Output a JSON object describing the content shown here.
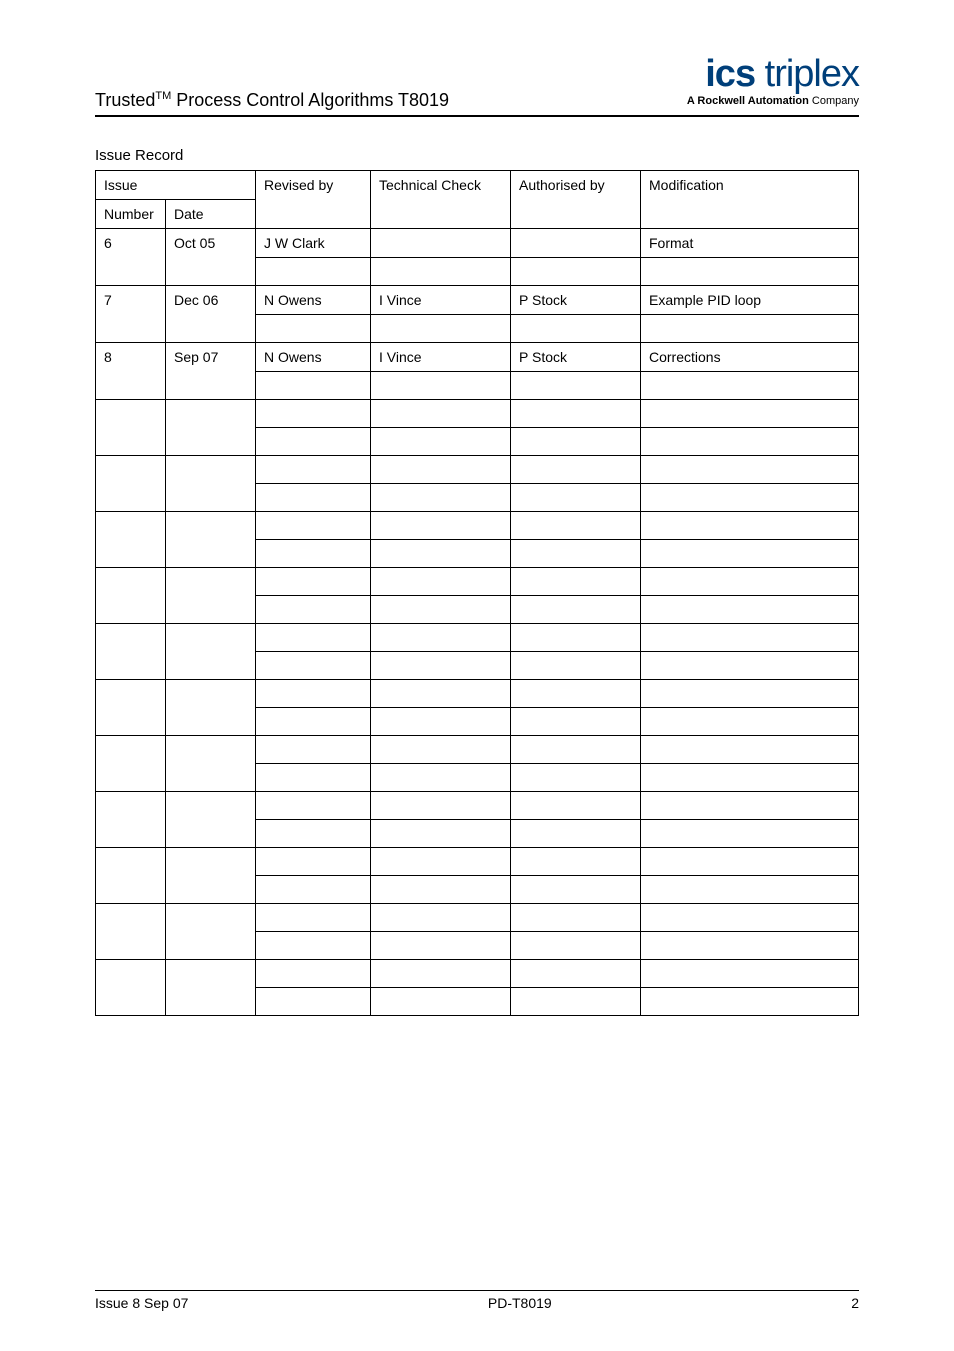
{
  "header": {
    "title_prefix": "Trusted",
    "title_sup": "TM",
    "title_suffix": " Process Control Algorithms T8019",
    "logo_ics": "ics",
    "logo_triplex": " triplex",
    "logo_tagline_bold": "A Rockwell Automation ",
    "logo_tagline_rest": "Company"
  },
  "section_title": "Issue Record",
  "table": {
    "group_header": "Issue",
    "columns": [
      "Number",
      "Date",
      "Revised by",
      "Technical Check",
      "Authorised by",
      "Modification"
    ],
    "rows": [
      {
        "number": "6",
        "date": "Oct 05",
        "revised": "J W Clark",
        "tech": "",
        "auth": "",
        "mod": "Format"
      },
      {
        "number": "7",
        "date": "Dec 06",
        "revised": "N Owens",
        "tech": "I Vince",
        "auth": "P Stock",
        "mod": "Example PID loop"
      },
      {
        "number": "8",
        "date": "Sep 07",
        "revised": "N Owens",
        "tech": "I Vince",
        "auth": "P Stock",
        "mod": "Corrections"
      },
      {
        "number": "",
        "date": "",
        "revised": "",
        "tech": "",
        "auth": "",
        "mod": ""
      },
      {
        "number": "",
        "date": "",
        "revised": "",
        "tech": "",
        "auth": "",
        "mod": ""
      },
      {
        "number": "",
        "date": "",
        "revised": "",
        "tech": "",
        "auth": "",
        "mod": ""
      },
      {
        "number": "",
        "date": "",
        "revised": "",
        "tech": "",
        "auth": "",
        "mod": ""
      },
      {
        "number": "",
        "date": "",
        "revised": "",
        "tech": "",
        "auth": "",
        "mod": ""
      },
      {
        "number": "",
        "date": "",
        "revised": "",
        "tech": "",
        "auth": "",
        "mod": ""
      },
      {
        "number": "",
        "date": "",
        "revised": "",
        "tech": "",
        "auth": "",
        "mod": ""
      },
      {
        "number": "",
        "date": "",
        "revised": "",
        "tech": "",
        "auth": "",
        "mod": ""
      },
      {
        "number": "",
        "date": "",
        "revised": "",
        "tech": "",
        "auth": "",
        "mod": ""
      },
      {
        "number": "",
        "date": "",
        "revised": "",
        "tech": "",
        "auth": "",
        "mod": ""
      },
      {
        "number": "",
        "date": "",
        "revised": "",
        "tech": "",
        "auth": "",
        "mod": ""
      }
    ]
  },
  "footer": {
    "left": "Issue 8 Sep 07",
    "center": "PD-T8019",
    "right": "2"
  }
}
